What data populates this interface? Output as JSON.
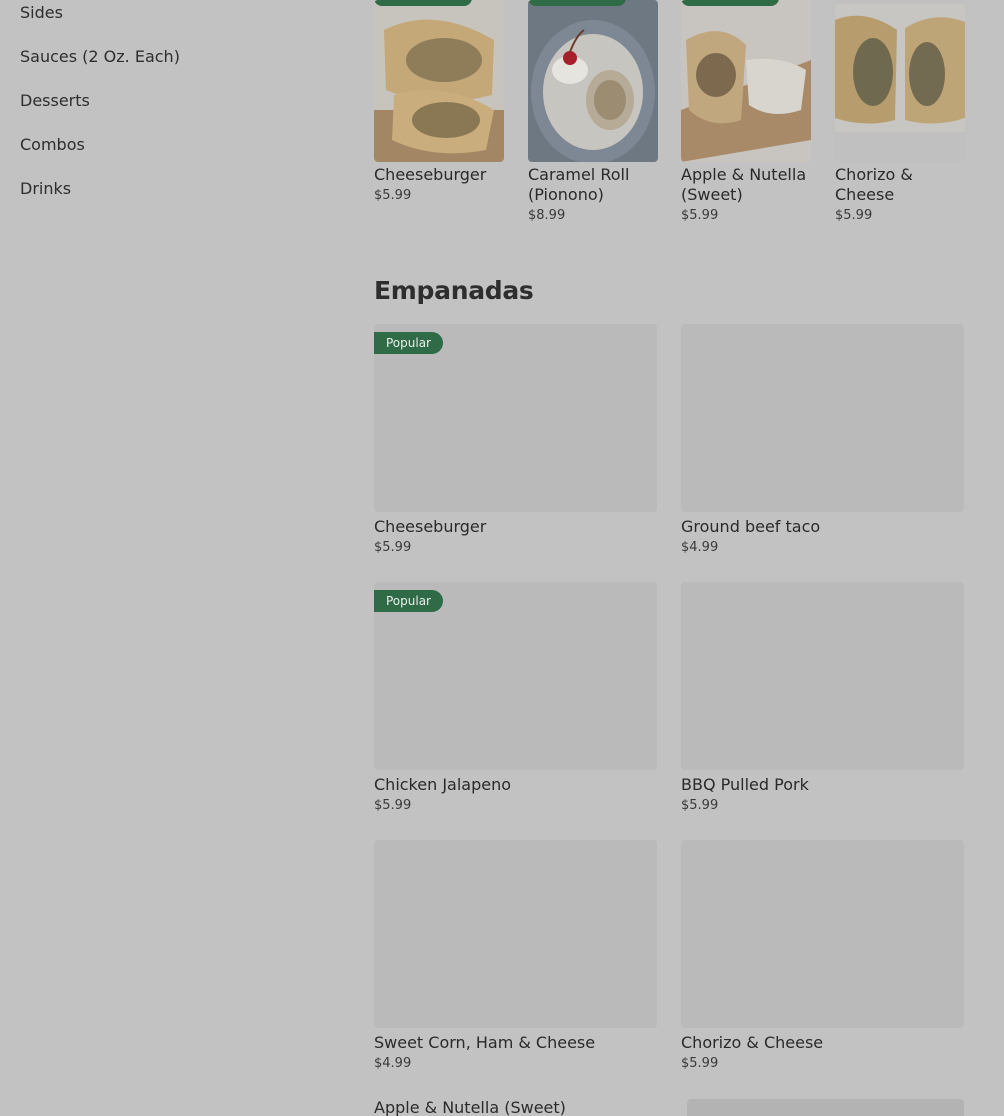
{
  "sidebar": {
    "items": [
      {
        "label": "Sides"
      },
      {
        "label": "Sauces (2 Oz. Each)"
      },
      {
        "label": "Desserts"
      },
      {
        "label": "Combos"
      },
      {
        "label": "Drinks"
      }
    ]
  },
  "carousel": {
    "items": [
      {
        "name": "Cheeseburger",
        "price": "$5.99"
      },
      {
        "name": "Caramel Roll (Pionono)",
        "price": "$8.99"
      },
      {
        "name": "Apple & Nutella (Sweet)",
        "price": "$5.99"
      },
      {
        "name": "Chorizo & Cheese",
        "price": "$5.99"
      }
    ]
  },
  "section": {
    "title": "Empanadas",
    "badge_label": "Popular",
    "items": [
      {
        "name": "Cheeseburger",
        "price": "$5.99"
      },
      {
        "name": "Ground beef taco",
        "price": "$4.99"
      },
      {
        "name": "Chicken Jalapeno",
        "price": "$5.99"
      },
      {
        "name": "BBQ Pulled Pork",
        "price": "$5.99"
      },
      {
        "name": "Sweet Corn, Ham & Cheese",
        "price": "$4.99"
      },
      {
        "name": "Chorizo & Cheese",
        "price": "$5.99"
      },
      {
        "name": "Apple & Nutella (Sweet)"
      }
    ]
  },
  "colors": {
    "overlay_background": "#c2c2c2",
    "badge_green": "#2f6b47",
    "placeholder_gray": "#bababa"
  }
}
